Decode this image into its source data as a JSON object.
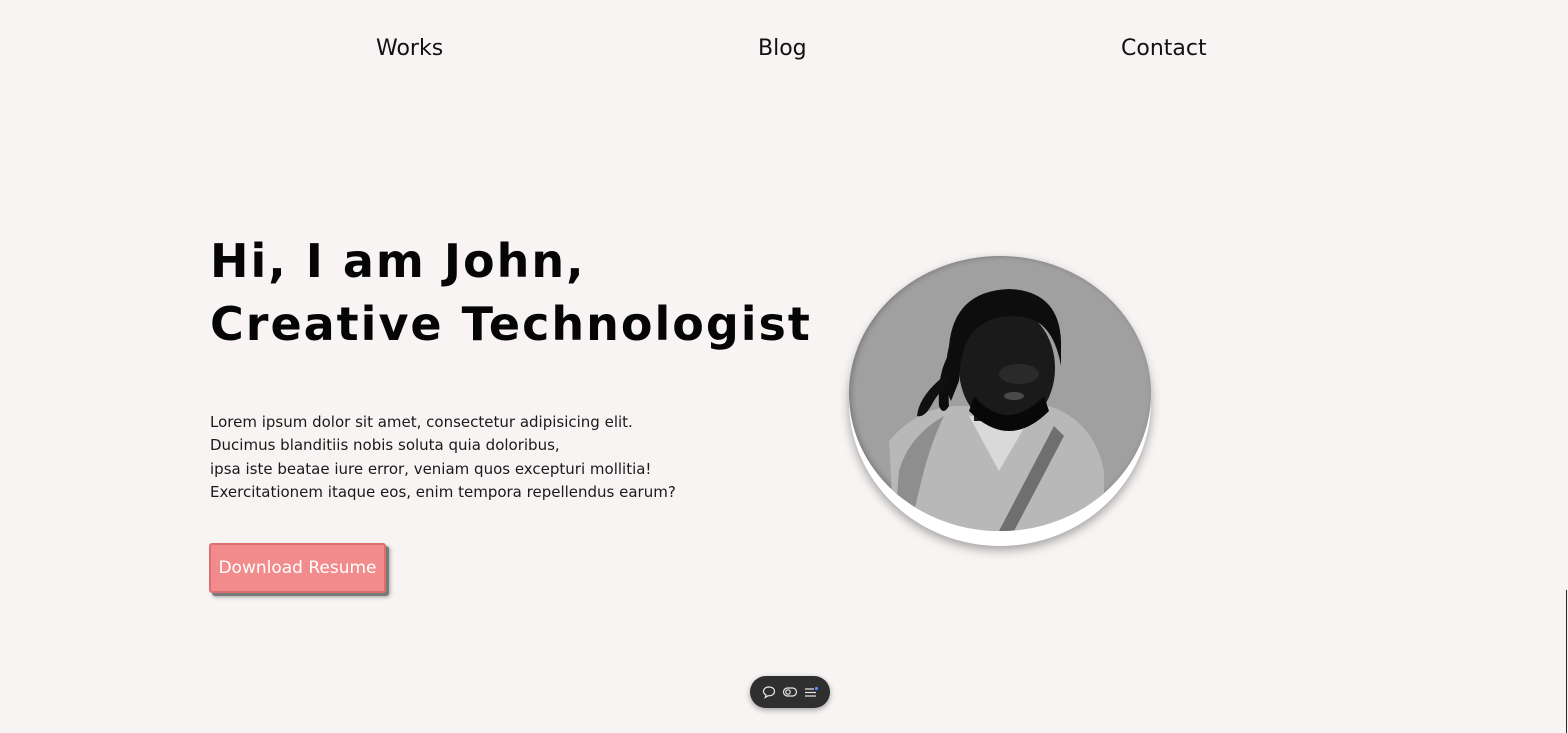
{
  "nav": {
    "works": "Works",
    "blog": "Blog",
    "contact": "Contact"
  },
  "hero": {
    "title_line1": "Hi, I am John,",
    "title_line2": "Creative Technologist",
    "text_lines": [
      "Lorem ipsum dolor sit amet, consectetur adipisicing elit.",
      "Ducimus blanditiis nobis soluta quia doloribus,",
      "ipsa iste beatae iure error, veniam quos excepturi mollitia!",
      "Exercitationem itaque eos, enim tempora repellendus earum?"
    ],
    "button_label": "Download Resume",
    "button_color": "#f28b8b"
  },
  "portrait": {
    "icon": "profile-photo"
  },
  "toolbar": {
    "icons": [
      "comment-icon",
      "toggle-icon",
      "menu-icon"
    ],
    "accent": "#4c8dff"
  },
  "colors": {
    "background": "#f7f4f3",
    "text": "#111111"
  }
}
